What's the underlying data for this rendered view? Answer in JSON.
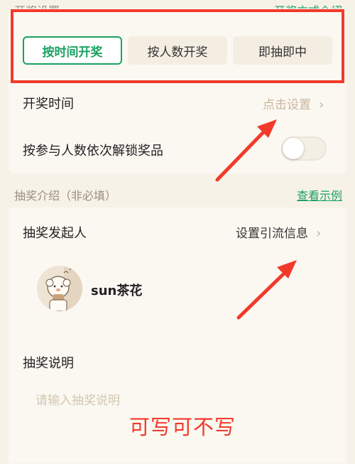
{
  "top_section": {
    "label": "开奖设置",
    "link": "开奖方式介绍"
  },
  "modes": [
    {
      "label": "按时间开奖",
      "active": true
    },
    {
      "label": "按人数开奖",
      "active": false
    },
    {
      "label": "即抽即中",
      "active": false
    }
  ],
  "draw_time": {
    "label": "开奖时间",
    "value": "点击设置",
    "chevron": "›"
  },
  "unlock_toggle": {
    "label": "按参与人数依次解锁奖品",
    "on": false
  },
  "intro_section": {
    "label": "抽奖介绍（非必填）",
    "link": "查看示例"
  },
  "initiator": {
    "label": "抽奖发起人",
    "value": "设置引流信息",
    "chevron": "›",
    "name": "sun茶花",
    "avatar_icon": "avatar-icon"
  },
  "description": {
    "label": "抽奖说明",
    "placeholder": "请输入抽奖说明"
  },
  "annotation": {
    "text": "可写可不写"
  },
  "colors": {
    "accent": "#1aa260",
    "annotation_red": "#f23a2a",
    "background": "#f7f2e8"
  }
}
